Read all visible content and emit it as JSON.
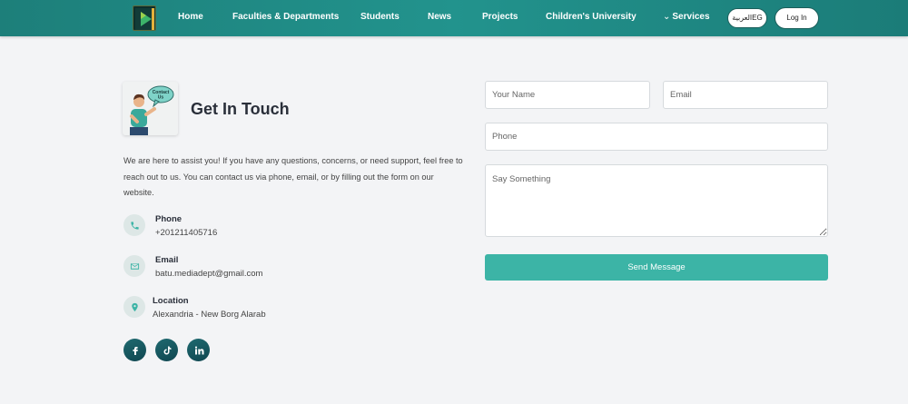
{
  "nav": {
    "items": [
      "Home",
      "Faculties & Departments",
      "Students",
      "News",
      "Projects",
      "Children's University"
    ],
    "services_label": "Services",
    "lang_label": "العربيةEG",
    "login_label": "Log In"
  },
  "contact": {
    "illustration_text": "Contact Us",
    "title": "Get In Touch",
    "intro": "We are here to assist you! If you have any questions, concerns, or need support, feel free to reach out to us. You can contact us via phone, email, or by filling out the form on our website.",
    "phone_label": "Phone",
    "phone_value": "+201211405716",
    "email_label": "Email",
    "email_value": "batu.mediadept@gmail.com",
    "location_label": "Location",
    "location_value": "Alexandria - New Borg Alarab",
    "socials": [
      "facebook-icon",
      "tiktok-icon",
      "linkedin-icon"
    ]
  },
  "form": {
    "name_placeholder": "Your Name",
    "email_placeholder": "Email",
    "phone_placeholder": "Phone",
    "message_placeholder": "Say Something",
    "send_label": "Send Message"
  },
  "colors": {
    "navbar": "#1d7f7a",
    "accent": "#3cb4a6",
    "social": "#15555d",
    "background": "#f3f4f6"
  }
}
